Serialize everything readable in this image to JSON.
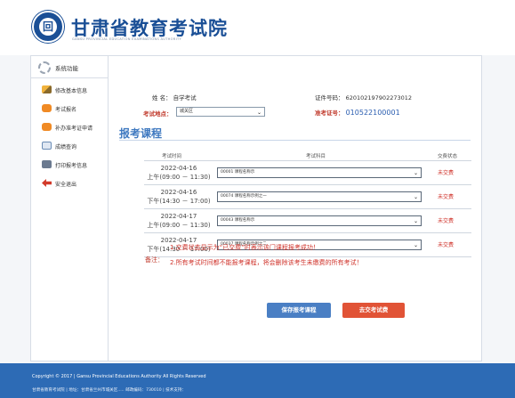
{
  "header": {
    "title": "甘肃省教育考试院",
    "subtitle": "GANSU PROVINCIAL EDUCATION EXAMINATIONS AUTHORITY",
    "logo_glyph": "回"
  },
  "sidebar": {
    "heading": "系统功能",
    "items": [
      {
        "label": "修改基本信息",
        "icon": "pencil-icon"
      },
      {
        "label": "考试报名",
        "icon": "orange-badge-icon"
      },
      {
        "label": "补办准考证申请",
        "icon": "orange-badge-icon"
      },
      {
        "label": "成绩查询",
        "icon": "document-icon"
      },
      {
        "label": "打印报考信息",
        "icon": "printer-icon"
      },
      {
        "label": "安全退出",
        "icon": "exit-arrow-icon"
      }
    ]
  },
  "info": {
    "name_label": "姓 名：",
    "name_value": "自学考试",
    "id_label": "证件号码：",
    "id_value": "620102197902273012",
    "location_label": "考试地点：",
    "location_value": "城关区",
    "ticket_label": "准考证号：",
    "ticket_value": "010522100001"
  },
  "section_title": "报考课程",
  "table": {
    "headers": [
      "考试时间",
      "考试科目",
      "交费状态"
    ],
    "rows": [
      {
        "date": "2022-04-16",
        "time": "上午(09:00 － 11:30)",
        "subject": "00001 课程名称示",
        "status": "未交费"
      },
      {
        "date": "2022-04-16",
        "time": "下午(14:30 － 17:00)",
        "subject": "00074 课程名称示例之一",
        "status": "未交费"
      },
      {
        "date": "2022-04-17",
        "time": "上午(09:00 － 11:30)",
        "subject": "00043 课程名称示",
        "status": "未交费"
      },
      {
        "date": "2022-04-17",
        "time": "下午(14:30 － 17:00)",
        "subject": "00037 课程名称示例之二",
        "status": "未交费"
      }
    ]
  },
  "notes": {
    "label": "备注：",
    "line1": "1.交费状态显示为“已交费”时表示该门课程报考成功！",
    "line2": "2.所有考试时间都不能报考课程，将会删除该考生未缴费的所有考试！"
  },
  "buttons": {
    "save": "保存报考课程",
    "submit": "去交考试费"
  },
  "footer": {
    "copyright": "Copyright © 2017 | Gansu Provincial Educations Authority All Rights Reserved",
    "address": "甘肃省教育考试院 | 地址：甘肃省兰州市城关区..... 邮政编码：730010 | 技术支持："
  },
  "colors": {
    "brand_blue": "#1a4f96",
    "accent_blue": "#3f79c0",
    "alert_red": "#d0342c",
    "footer_blue": "#2d6bb5"
  }
}
